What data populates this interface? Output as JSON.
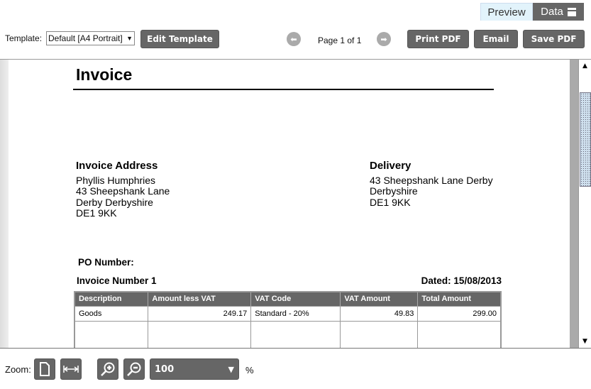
{
  "tabs": {
    "preview": "Preview",
    "data": "Data"
  },
  "toolbar": {
    "template_label": "Template:",
    "template_value": "Default [A4 Portrait]",
    "edit_template": "Edit Template",
    "page_info": "Page 1 of 1",
    "print_pdf": "Print PDF",
    "email": "Email",
    "save_pdf": "Save PDF"
  },
  "invoice": {
    "title": "Invoice",
    "invoice_address": {
      "heading": "Invoice Address",
      "lines": [
        "Phyllis Humphries",
        "43 Sheepshank Lane",
        "Derby Derbyshire",
        "DE1 9KK"
      ]
    },
    "delivery": {
      "heading": "Delivery",
      "lines": [
        "43 Sheepshank Lane Derby",
        "Derbyshire",
        "DE1 9KK"
      ]
    },
    "po_number": "PO Number:",
    "invoice_number": "Invoice Number 1",
    "dated": "Dated: 15/08/2013",
    "columns": [
      "Description",
      "Amount less VAT",
      "VAT Code",
      "VAT Amount",
      "Total Amount"
    ],
    "rows": [
      [
        "Goods",
        "249.17",
        "Standard - 20%",
        "49.83",
        "299.00"
      ]
    ]
  },
  "zoom": {
    "label": "Zoom:",
    "value": "100",
    "unit": "%"
  }
}
